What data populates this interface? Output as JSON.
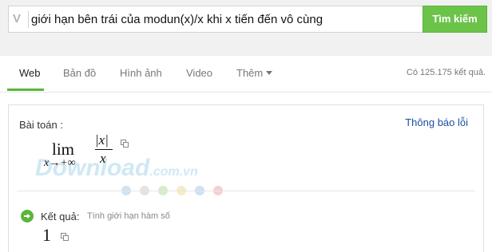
{
  "search": {
    "logo_letter": "V",
    "query": "giới hạn bên trái của modun(x)/x khi x tiến đến vô cùng",
    "button_label": "Tìm kiếm"
  },
  "tabs": [
    {
      "label": "Web",
      "active": true
    },
    {
      "label": "Bản đồ",
      "active": false
    },
    {
      "label": "Hình ảnh",
      "active": false
    },
    {
      "label": "Video",
      "active": false
    },
    {
      "label": "Thêm",
      "active": false
    }
  ],
  "result_count": "Có 125.175 kết quả.",
  "card": {
    "problem_label": "Bài toán :",
    "report_link": "Thông báo lỗi",
    "expression": {
      "lim": "lim",
      "subscript": "x→+∞",
      "numerator": "|x|",
      "denominator": "x"
    },
    "result_label": "Kết quả:",
    "result_desc": "Tính giới hạn hàm số",
    "answer": "1"
  },
  "watermark": {
    "main": "Download",
    "suffix": ".com.vn",
    "dot_colors": [
      "#cfe3f2",
      "#e3e3e3",
      "#d9ecc8",
      "#f6ecc4",
      "#cfe0f2",
      "#f6cfcf"
    ]
  },
  "colors": {
    "accent_green": "#6cc34a",
    "link_blue": "#1a4fa3"
  }
}
